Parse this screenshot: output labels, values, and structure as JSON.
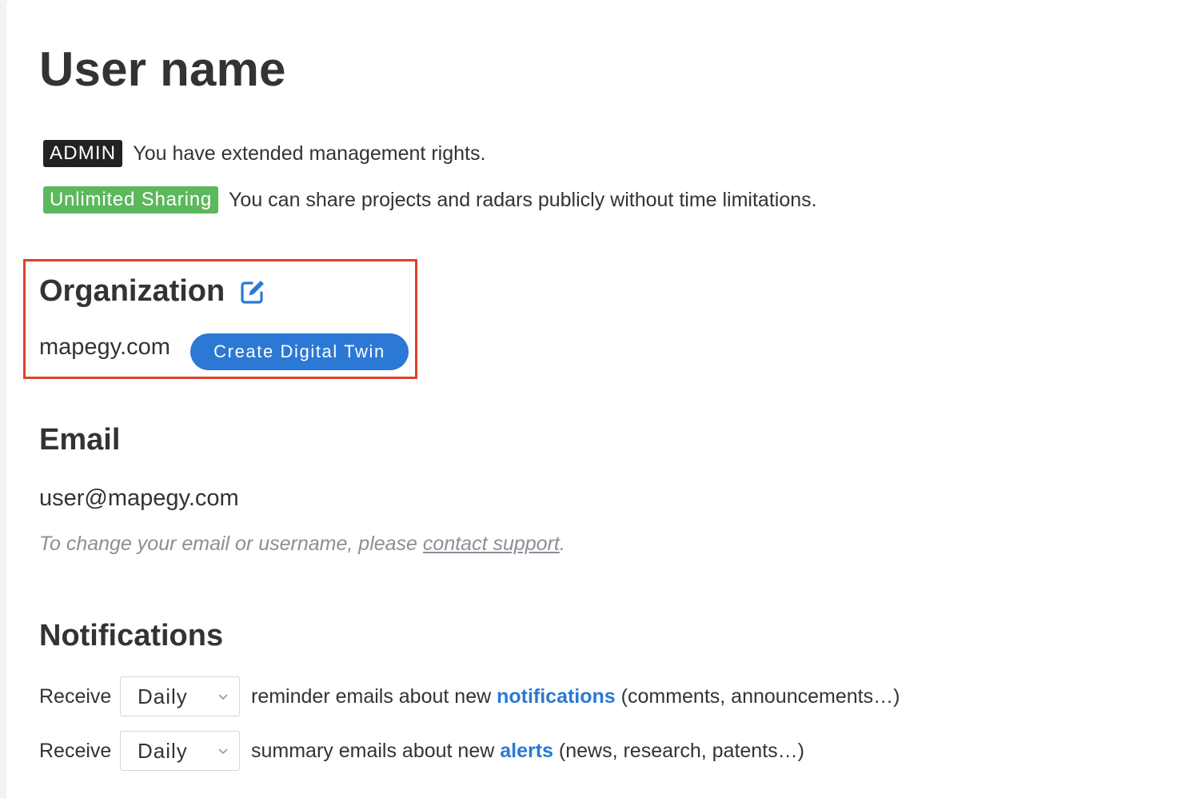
{
  "header": {
    "title": "User name"
  },
  "badges": [
    {
      "label": "ADMIN",
      "description": "You have extended management rights.",
      "color": "#222222"
    },
    {
      "label": "Unlimited Sharing",
      "description": "You can share projects and radars publicly without time limitations.",
      "color": "#5cb85c"
    }
  ],
  "organization": {
    "heading": "Organization",
    "edit_icon": "edit-icon",
    "value": "mapegy.com",
    "create_button_label": "Create Digital Twin"
  },
  "email": {
    "heading": "Email",
    "value": "user@mapegy.com",
    "note_prefix": "To change your email or username, please ",
    "note_link": "contact support",
    "note_suffix": "."
  },
  "notifications": {
    "heading": "Notifications",
    "rows": [
      {
        "label": "Receive",
        "frequency": "Daily",
        "text_before": "reminder emails about new ",
        "link": "notifications",
        "text_after": " (comments, announcements…)"
      },
      {
        "label": "Receive",
        "frequency": "Daily",
        "text_before": "summary emails about new ",
        "link": "alerts",
        "text_after": " (news, research, patents…)"
      }
    ]
  },
  "colors": {
    "accent": "#2b79d4",
    "highlight_border": "#e0402a"
  }
}
